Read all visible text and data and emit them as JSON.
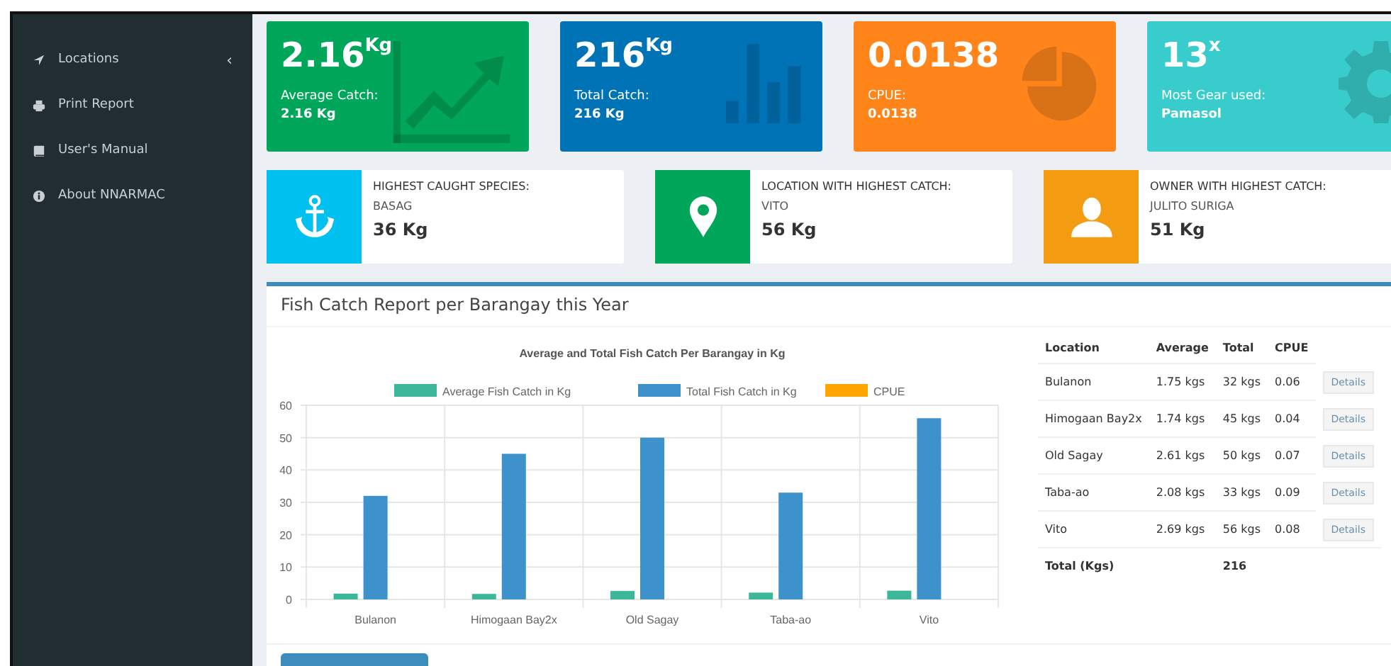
{
  "sidebar": {
    "items": [
      {
        "label": "Locations",
        "caret": "‹"
      },
      {
        "label": "Print Report"
      },
      {
        "label": "User's Manual"
      },
      {
        "label": "About NNARMAC"
      }
    ]
  },
  "stat_boxes": [
    {
      "value": "2.16",
      "unit": "Kg",
      "label": "Average Catch:",
      "detail": "2.16 Kg",
      "color": "#00a65a"
    },
    {
      "value": "216",
      "unit": "Kg",
      "label": "Total Catch:",
      "detail": "216 Kg",
      "color": "#0073b7"
    },
    {
      "value": "0.0138",
      "label": "CPUE:",
      "detail": "0.0138",
      "color": "#ff851b"
    },
    {
      "value": "13",
      "unit": "x",
      "label": "Most Gear used:",
      "detail": "Pamasol",
      "color": "#39cccc"
    }
  ],
  "info_boxes": [
    {
      "title": "HIGHEST CAUGHT SPECIES:",
      "subtitle": "BASAG",
      "value": "36 Kg",
      "color": "#00c0ef"
    },
    {
      "title": "LOCATION WITH HIGHEST CATCH:",
      "subtitle": "VITO",
      "value": "56 Kg",
      "color": "#00a65a"
    },
    {
      "title": "OWNER WITH HIGHEST CATCH:",
      "subtitle": "JULITO SURIGA",
      "value": "51 Kg",
      "color": "#f39c12"
    }
  ],
  "report": {
    "title": "Fish Catch Report per Barangay this Year",
    "chart_data": {
      "type": "bar",
      "title": "Average and Total Fish Catch Per Barangay in Kg",
      "categories": [
        "Bulanon",
        "Himogaan Bay2x",
        "Old Sagay",
        "Taba-ao",
        "Vito"
      ],
      "series": [
        {
          "name": "Average Fish Catch in Kg",
          "color": "#3cb79a",
          "values": [
            1.8,
            1.7,
            2.6,
            2.1,
            2.7
          ]
        },
        {
          "name": "Total Fish Catch in Kg",
          "color": "#3d92cc",
          "values": [
            32,
            45,
            50,
            33,
            56
          ]
        },
        {
          "name": "CPUE",
          "color": "#ffa500",
          "values": [
            null,
            null,
            null,
            null,
            null
          ]
        }
      ],
      "ylim": [
        0,
        60
      ],
      "yticks": [
        0,
        10,
        20,
        30,
        40,
        50,
        60
      ],
      "grid": true,
      "legend": true
    },
    "table": {
      "columns": [
        "Location",
        "Average",
        "Total",
        "CPUE"
      ],
      "rows": [
        {
          "location": "Bulanon",
          "average": "1.75 kgs",
          "total": "32 kgs",
          "cpue": "0.06",
          "action": "Details"
        },
        {
          "location": "Himogaan Bay2x",
          "average": "1.74 kgs",
          "total": "45 kgs",
          "cpue": "0.04",
          "action": "Details"
        },
        {
          "location": "Old Sagay",
          "average": "2.61 kgs",
          "total": "50 kgs",
          "cpue": "0.07",
          "action": "Details"
        },
        {
          "location": "Taba-ao",
          "average": "2.08 kgs",
          "total": "33 kgs",
          "cpue": "0.09",
          "action": "Details"
        },
        {
          "location": "Vito",
          "average": "2.69 kgs",
          "total": "56 kgs",
          "cpue": "0.08",
          "action": "Details"
        }
      ],
      "footer": {
        "label": "Total (Kgs)",
        "total": "216"
      }
    }
  }
}
